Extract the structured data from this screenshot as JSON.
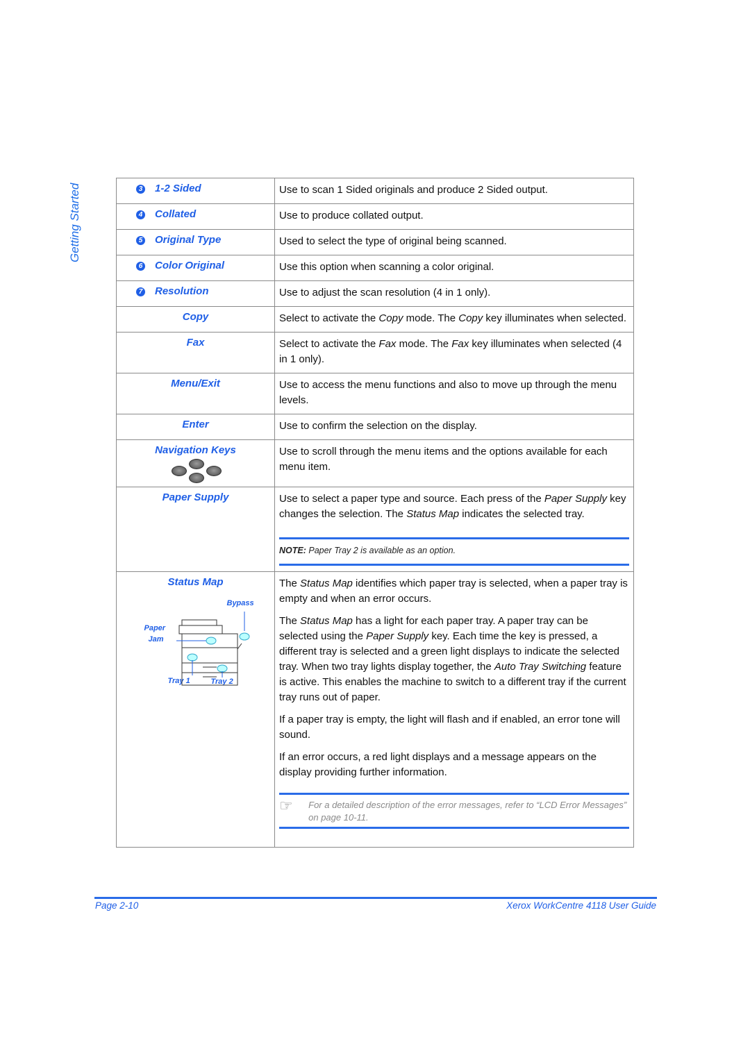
{
  "side_tab": "Getting Started",
  "rows": [
    {
      "num": "3",
      "key": "1-2 Sided",
      "desc": "Use to scan 1 Sided originals and produce 2 Sided output."
    },
    {
      "num": "4",
      "key": "Collated",
      "desc": "Use to produce collated output."
    },
    {
      "num": "5",
      "key": "Original Type",
      "desc": "Used to select the type of original being scanned."
    },
    {
      "num": "6",
      "key": "Color Original",
      "desc": "Use this option when scanning a color original."
    },
    {
      "num": "7",
      "key": "Resolution",
      "desc": "Use to adjust the scan resolution (4 in 1 only)."
    }
  ],
  "copy": {
    "key": "Copy",
    "d1": "Select to activate the ",
    "d2": "Copy",
    "d3": " mode. The ",
    "d4": "Copy",
    "d5": " key illuminates when selected."
  },
  "fax": {
    "key": "Fax",
    "d1": "Select to activate the ",
    "d2": "Fax",
    "d3": " mode. The ",
    "d4": "Fax",
    "d5": " key illuminates when selected (4 in 1 only)."
  },
  "menu_exit": {
    "key": "Menu/Exit",
    "desc": "Use to access the menu functions and also to move up through the menu levels."
  },
  "enter": {
    "key": "Enter",
    "desc": "Use to confirm the selection on the display."
  },
  "nav_keys": {
    "key": "Navigation Keys",
    "desc": "Use to scroll through the menu items and the options available for each menu item."
  },
  "paper_supply": {
    "key": "Paper Supply",
    "d1": "Use to select a paper type and source. Each press of the ",
    "d2": "Paper Supply",
    "d3": " key changes the selection. The ",
    "d4": "Status Map",
    "d5": " indicates the selected tray.",
    "note_label": "NOTE:",
    "note_text": " Paper Tray 2 is available as an option."
  },
  "status_map": {
    "key": "Status Map",
    "labels": {
      "bypass": "Bypass",
      "paper": "Paper",
      "jam": "Jam",
      "tray1": "Tray 1",
      "tray2": "Tray 2"
    },
    "p1a": "The ",
    "p1b": "Status Map",
    "p1c": " identifies which paper tray is selected, when a paper tray is empty and when an error occurs.",
    "p2a": "The ",
    "p2b": "Status Map",
    "p2c": " has a light for each paper tray. A paper tray can be selected using the ",
    "p2d": "Paper Supply",
    "p2e": " key. Each time the key is pressed, a different tray is selected and a green light displays to indicate the selected tray. When two tray lights display together, the ",
    "p2f": "Auto Tray Switching",
    "p2g": " feature is active. This enables the machine to switch to a different tray if the current tray runs out of paper.",
    "p3": "If a paper tray is empty, the light will flash and if enabled, an error tone will sound.",
    "p4": "If an error occurs, a red light displays and a message appears on the display providing further information.",
    "tip": "For a detailed description of the error messages, refer to “LCD Error Messages” on page 10-11."
  },
  "footer": {
    "page": "Page 2-10",
    "guide": "Xerox WorkCentre 4118 User Guide"
  }
}
